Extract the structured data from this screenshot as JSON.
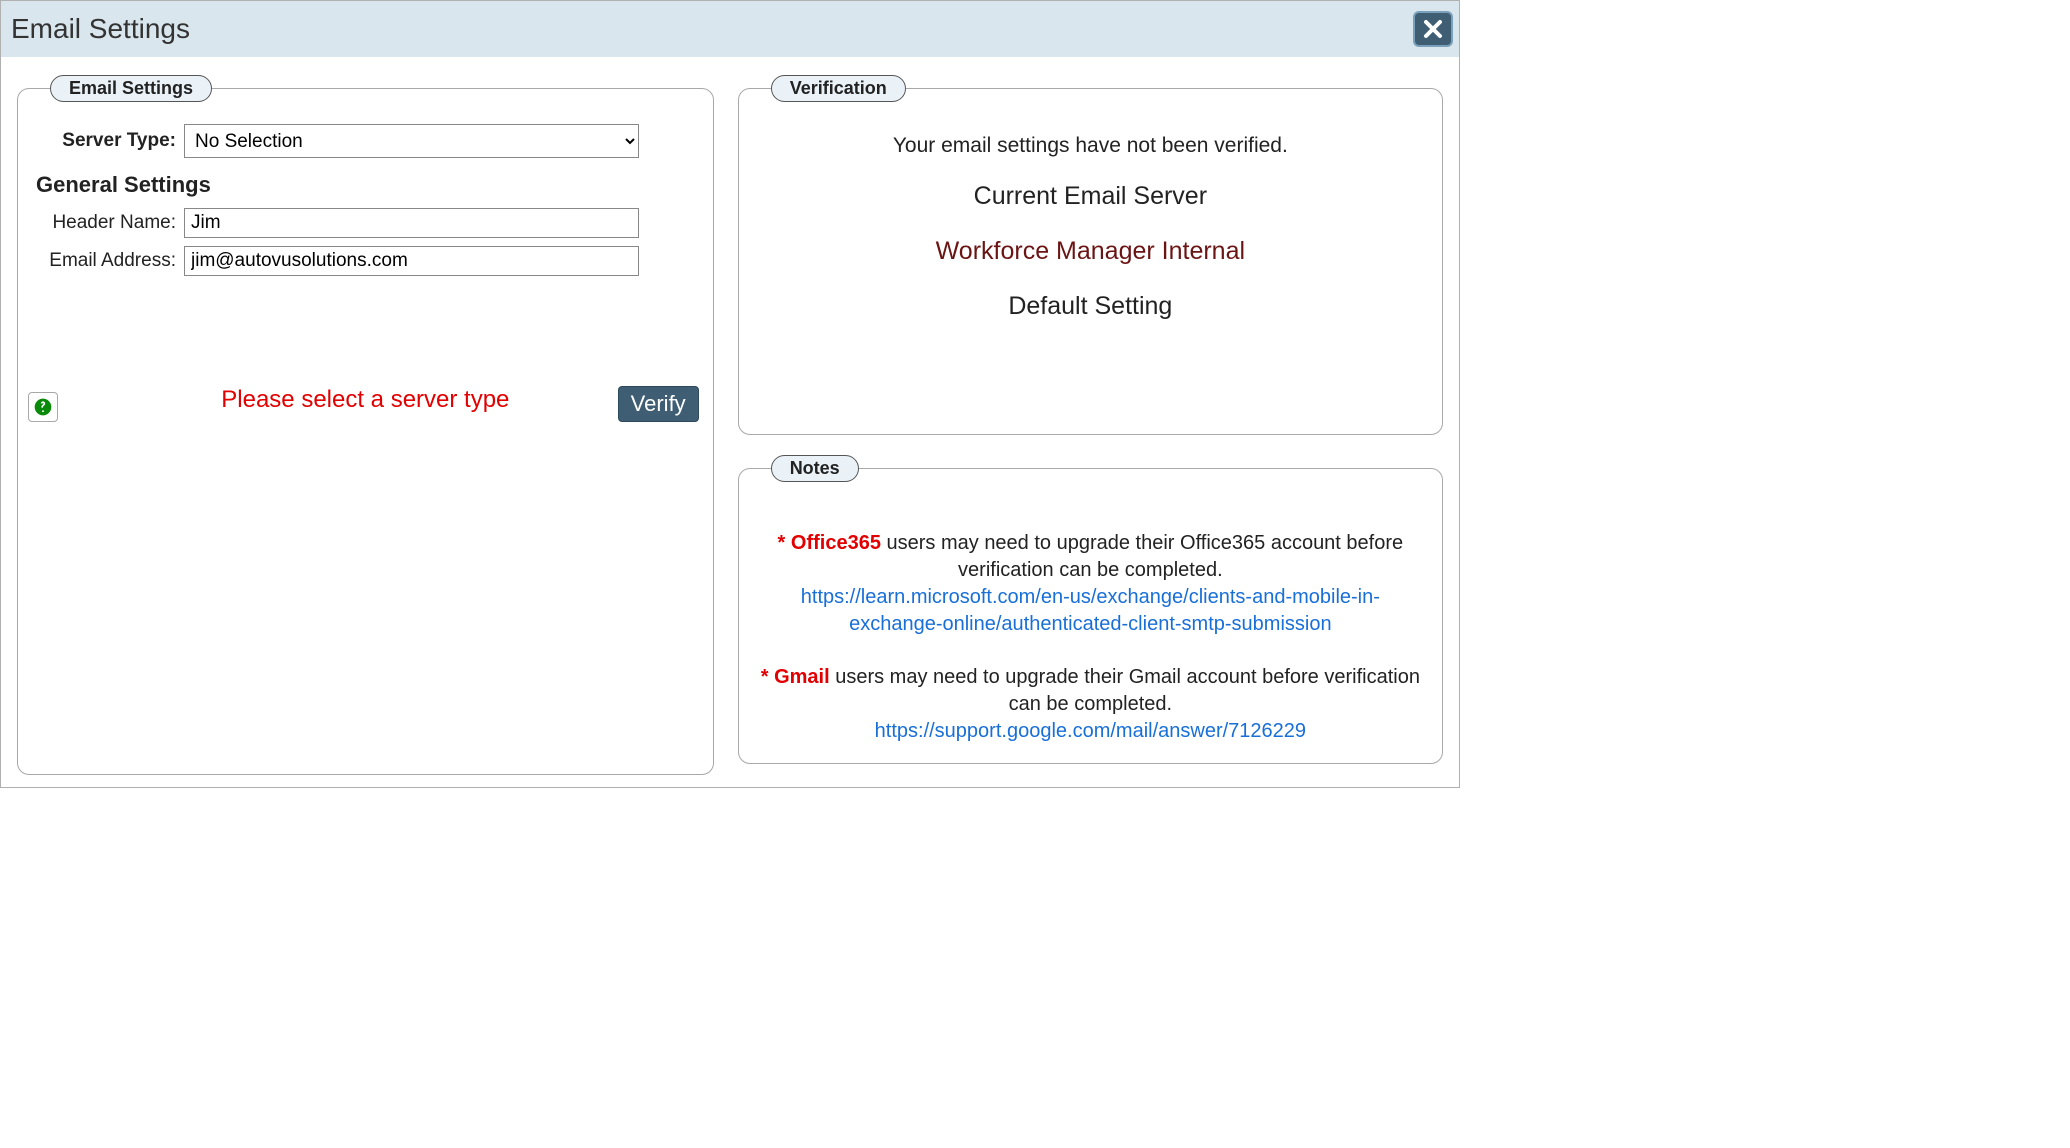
{
  "window": {
    "title": "Email Settings"
  },
  "emailSettings": {
    "legend": "Email Settings",
    "serverTypeLabel": "Server Type:",
    "serverTypeValue": "No Selection",
    "generalHeading": "General Settings",
    "headerNameLabel": "Header Name:",
    "headerNameValue": "Jim",
    "emailAddressLabel": "Email Address:",
    "emailAddressValue": "jim@autovusolutions.com",
    "warning": "Please select a server type",
    "verifyLabel": "Verify"
  },
  "verification": {
    "legend": "Verification",
    "message": "Your email settings have not been verified.",
    "currentLabel": "Current Email Server",
    "serverName": "Workforce Manager Internal",
    "defaultLabel": "Default Setting"
  },
  "notes": {
    "legend": "Notes",
    "office365": {
      "star": "* ",
      "provider": "Office365",
      "text": " users may need to upgrade their Office365 account before verification can be completed.",
      "link": "https://learn.microsoft.com/en-us/exchange/clients-and-mobile-in-exchange-online/authenticated-client-smtp-submission"
    },
    "gmail": {
      "star": "* ",
      "provider": "Gmail",
      "text": " users may need to upgrade their Gmail account before verification can be completed.",
      "link": "https://support.google.com/mail/answer/7126229"
    }
  }
}
